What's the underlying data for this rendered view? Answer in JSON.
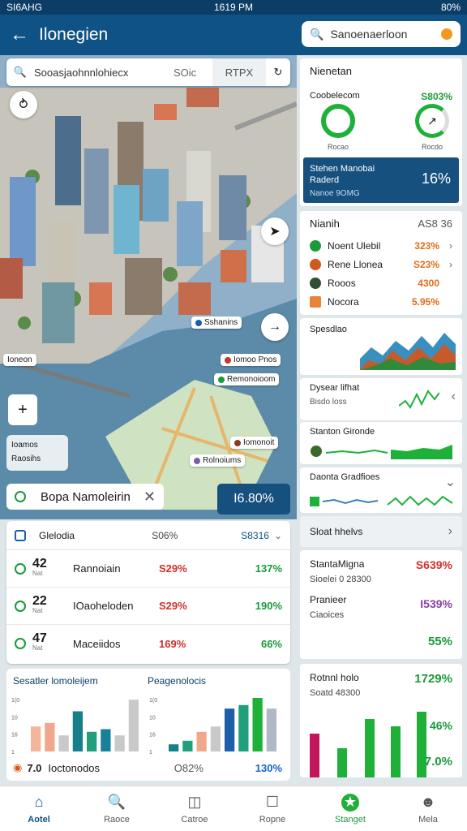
{
  "status": {
    "carrier": "SI6AHG",
    "time": "1619 PM",
    "battery": "80%"
  },
  "appbar": {
    "title": "Ilonegien",
    "search_placeholder": "Sanoenaerloon"
  },
  "map": {
    "search_query": "Sooasjaohnnlohiecx",
    "search_meta": "SOic",
    "search_chip": "RTPX",
    "legend": [
      "Ioamos",
      "Raosihs"
    ],
    "pins": [
      "Sshanins",
      "Iomoo Pnos",
      "Remonoioom",
      "Iomonoit",
      "Rolnoiums",
      "Ioneon"
    ],
    "place_title": "Bopa Namoleirin",
    "big_metric": "I6.80%"
  },
  "list": {
    "header": {
      "name": "Glelodia",
      "pct": "S06%",
      "code": "S8316"
    },
    "rows": [
      {
        "num": "42",
        "sub": "Nat",
        "name": "Rannoiain",
        "p1": "S29%",
        "p2": "137%"
      },
      {
        "num": "22",
        "sub": "Nat",
        "name": "IOaoheloden",
        "p1": "S29%",
        "p2": "190%"
      },
      {
        "num": "47",
        "sub": "Nat",
        "name": "Maceiidos",
        "p1": "169%",
        "p2": "66%"
      }
    ]
  },
  "chart_bottom": {
    "left_title": "Sesatler lomoleijem",
    "right_title": "Peagenolocis",
    "foot": {
      "num": "7.0",
      "name": "Ioctonodos",
      "pct": "O82%",
      "value": "130%"
    }
  },
  "chart_data": [
    {
      "type": "bar",
      "title": "Sesatler lomoleijem",
      "ylabel": "",
      "xlabel": "",
      "y_ticks": [
        "1(0",
        "10",
        "16",
        "1"
      ],
      "series": [
        {
          "values": [
            28,
            32,
            18,
            45,
            22,
            25,
            18,
            58
          ]
        }
      ]
    },
    {
      "type": "bar",
      "title": "Peagenolocis",
      "ylabel": "",
      "xlabel": "",
      "y_ticks": [
        "1(0",
        "10",
        "16",
        "1"
      ],
      "series": [
        {
          "values": [
            8,
            12,
            22,
            28,
            48,
            52,
            60,
            48
          ]
        }
      ]
    }
  ],
  "right_panel": {
    "summary": {
      "title": "Nienetan",
      "a_label": "Coobelecom",
      "a_value": "S803%",
      "b_label": "Rocao",
      "b_value": "Rocdo",
      "banner_title": "Stehen Manobai Raderd",
      "banner_sub": "Nanoe 9OMG",
      "banner_pct": "16%"
    },
    "ranks": {
      "title": "Nianih",
      "tag": "AS8 36",
      "items": [
        {
          "name": "Noent Ulebil",
          "value": "323%",
          "color": "#1a9a3a"
        },
        {
          "name": "Rene Llonea",
          "value": "S23%",
          "color": "#d05a1e"
        },
        {
          "name": "Rooos",
          "value": "4300",
          "color": "#2f4f2f"
        },
        {
          "name": "Nocora",
          "value": "5.95%",
          "color": "#e8833a"
        }
      ]
    },
    "trend": [
      "Spesdlao",
      "Dysear lifhat",
      "Stanton Gironde",
      "Daonta Gradfioes"
    ],
    "trend_sub": [
      "",
      "Bisdo loss",
      "",
      ""
    ],
    "solar": "Sloat hhelvs",
    "metrics": [
      {
        "name": "StantaMigna",
        "value": "S639%",
        "sub": "Sioelei 0 28300"
      },
      {
        "name": "Pranieer",
        "value": "I539%",
        "sub": "Ciaoices"
      },
      {
        "name": "",
        "value": "55%",
        "sub": ""
      }
    ],
    "bottom": {
      "title": "Rotnnl holo",
      "value": "1729%",
      "sub": "Soatd 48300",
      "bar_labels": [
        "46%",
        "7.0%"
      ]
    }
  },
  "chart_data_right": {
    "type": "bar",
    "values": [
      60,
      40,
      80,
      70,
      90
    ]
  },
  "nav": [
    {
      "label": "Aotel",
      "icon": "home-icon"
    },
    {
      "label": "Raoce",
      "icon": "search-icon"
    },
    {
      "label": "Catroe",
      "icon": "bag-icon"
    },
    {
      "label": "Ropne",
      "icon": "box-icon"
    },
    {
      "label": "Stanget",
      "icon": "star-icon"
    },
    {
      "label": "Mela",
      "icon": "profile-icon"
    }
  ]
}
